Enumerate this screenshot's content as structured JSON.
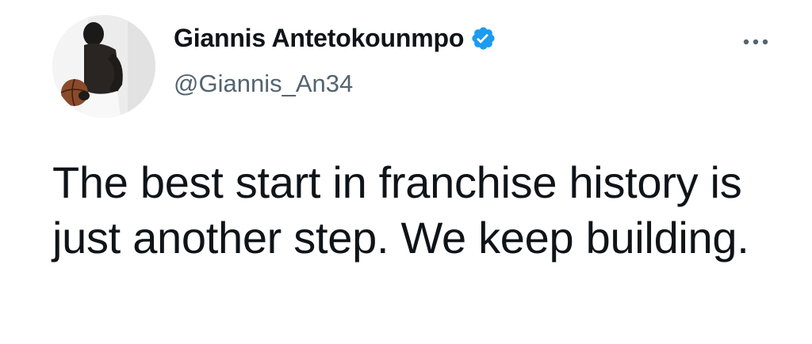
{
  "tweet": {
    "author": {
      "display_name": "Giannis Antetokounmpo",
      "handle": "@Giannis_An34",
      "verified": true,
      "avatar_icon": "avatar-photo"
    },
    "more_icon": "more-options-icon",
    "text": "The best start in franchise history is just another step. We keep building."
  },
  "colors": {
    "verified_blue": "#1d9bf0",
    "text_primary": "#0f1419",
    "text_secondary": "#536471"
  }
}
